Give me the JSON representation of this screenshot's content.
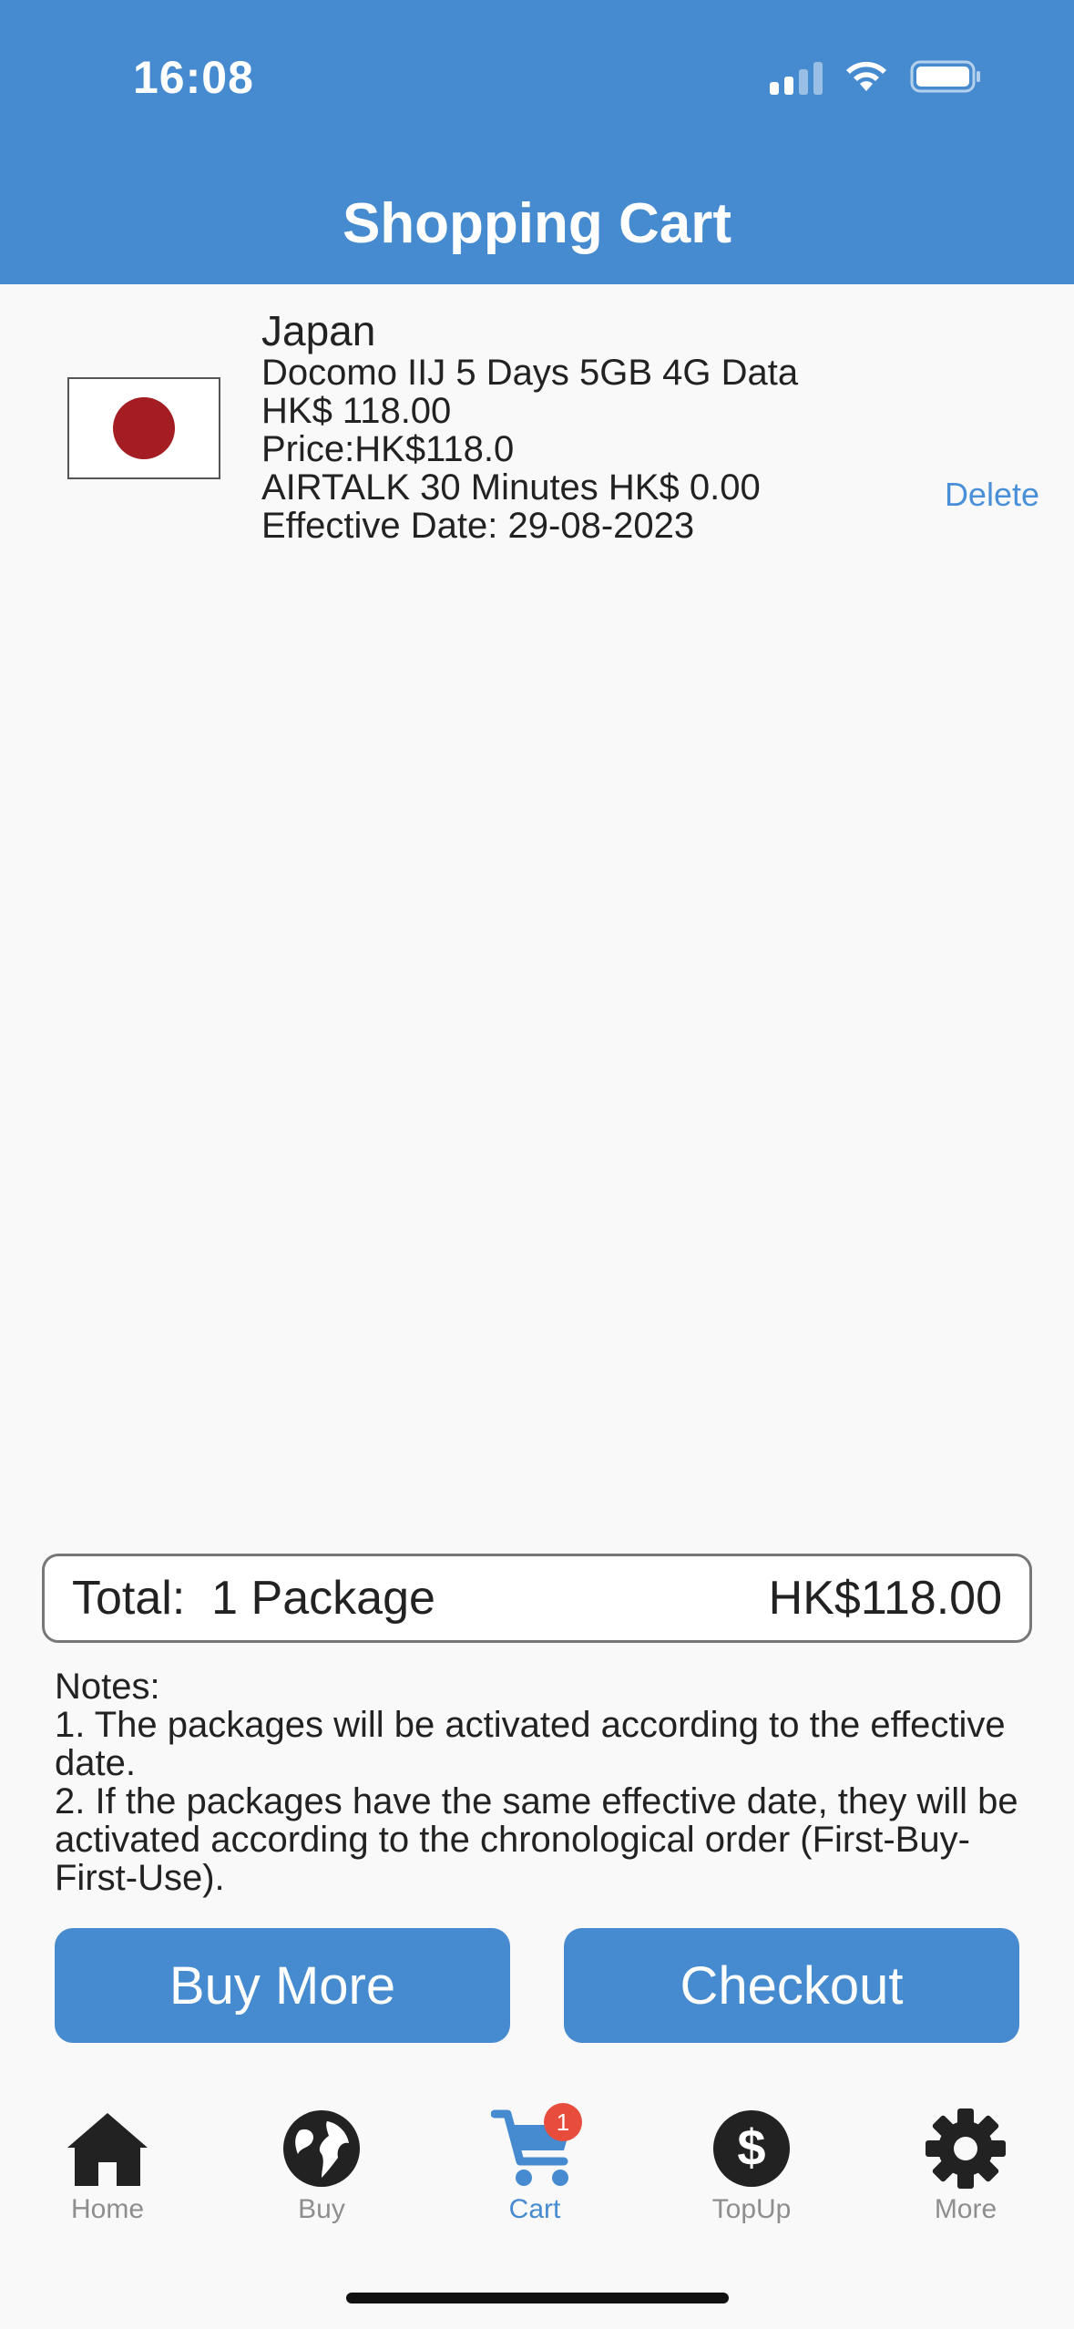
{
  "status_bar": {
    "time": "16:08"
  },
  "header": {
    "title": "Shopping Cart"
  },
  "cart": {
    "items": [
      {
        "country": "Japan",
        "package": "Docomo IIJ 5 Days 5GB 4G Data",
        "package_price": "HK$ 118.00",
        "price": "Price:HK$118.0",
        "addon": "AIRTALK 30 Minutes HK$ 0.00",
        "effective_date": "Effective Date: 29-08-2023",
        "delete_label": "Delete",
        "flag_icon": "japan-flag-icon"
      }
    ]
  },
  "total": {
    "label": "Total:  1 Package",
    "amount": "HK$118.00"
  },
  "notes": {
    "title": "Notes:",
    "line1": "1. The packages will be activated according to the effective date.",
    "line2": "2. If the packages have the same effective date, they will be activated according to the chronological order (First-Buy-First-Use)."
  },
  "actions": {
    "buy_more": "Buy More",
    "checkout": "Checkout"
  },
  "tabbar": {
    "tabs": [
      {
        "label": "Home",
        "icon": "home-icon"
      },
      {
        "label": "Buy",
        "icon": "globe-icon"
      },
      {
        "label": "Cart",
        "icon": "cart-icon",
        "badge": "1",
        "active": true
      },
      {
        "label": "TopUp",
        "icon": "dollar-icon"
      },
      {
        "label": "More",
        "icon": "gear-icon"
      }
    ]
  },
  "colors": {
    "primary": "#468bcf",
    "badge": "#e74c3c",
    "link": "#4a90d9"
  }
}
